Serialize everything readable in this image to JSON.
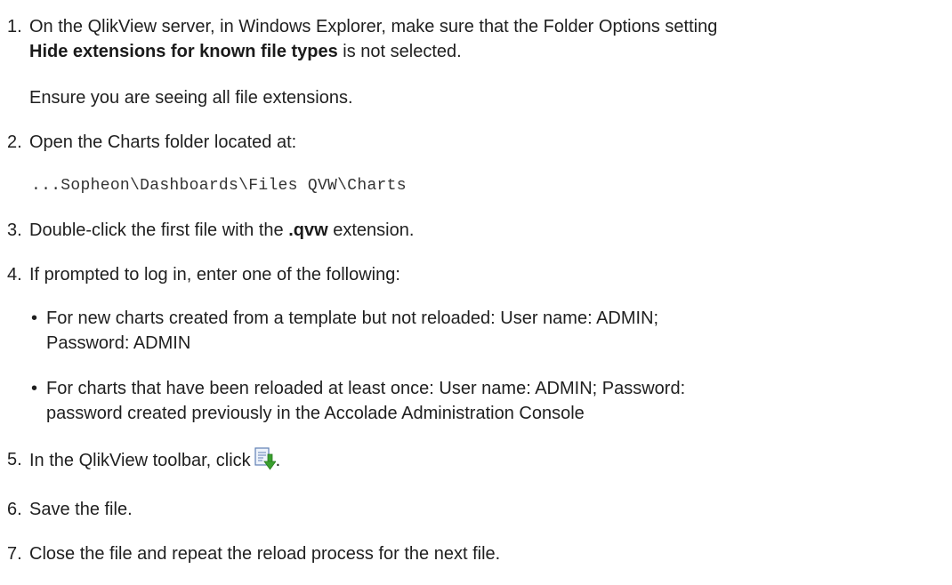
{
  "steps": [
    {
      "number": "1.",
      "lines": [
        "On the QlikView server, in Windows Explorer, make sure that the Folder Options setting"
      ],
      "bold": "Hide extensions for known file types",
      "after_bold": " is not selected.",
      "note": "Ensure you are seeing all file extensions."
    },
    {
      "number": "2.",
      "text": "Open the Charts folder located at:",
      "path": "...Sopheon\\Dashboards\\Files QVW\\Charts"
    },
    {
      "number": "3.",
      "before_bold": "Double-click the first file with the ",
      "bold": ".qvw",
      "after_bold": " extension."
    },
    {
      "number": "4.",
      "text": "If prompted to log in, enter one of the following:",
      "bullets": [
        {
          "line1": "For new charts created from a template but not reloaded: User name: ADMIN;",
          "line2": "Password: ADMIN"
        },
        {
          "line1": "For charts that have been reloaded at least once: User name: ADMIN; Password:",
          "line2": "password created previously in the Accolade Administration Console"
        }
      ],
      "bullet_char": "•"
    },
    {
      "number": "5.",
      "text": "In the QlikView toolbar, click",
      "after_icon": ".",
      "icon": "reload-icon"
    },
    {
      "number": "6.",
      "text": "Save the file."
    },
    {
      "number": "7.",
      "text": "Close the file and repeat the reload process for the next file."
    }
  ]
}
